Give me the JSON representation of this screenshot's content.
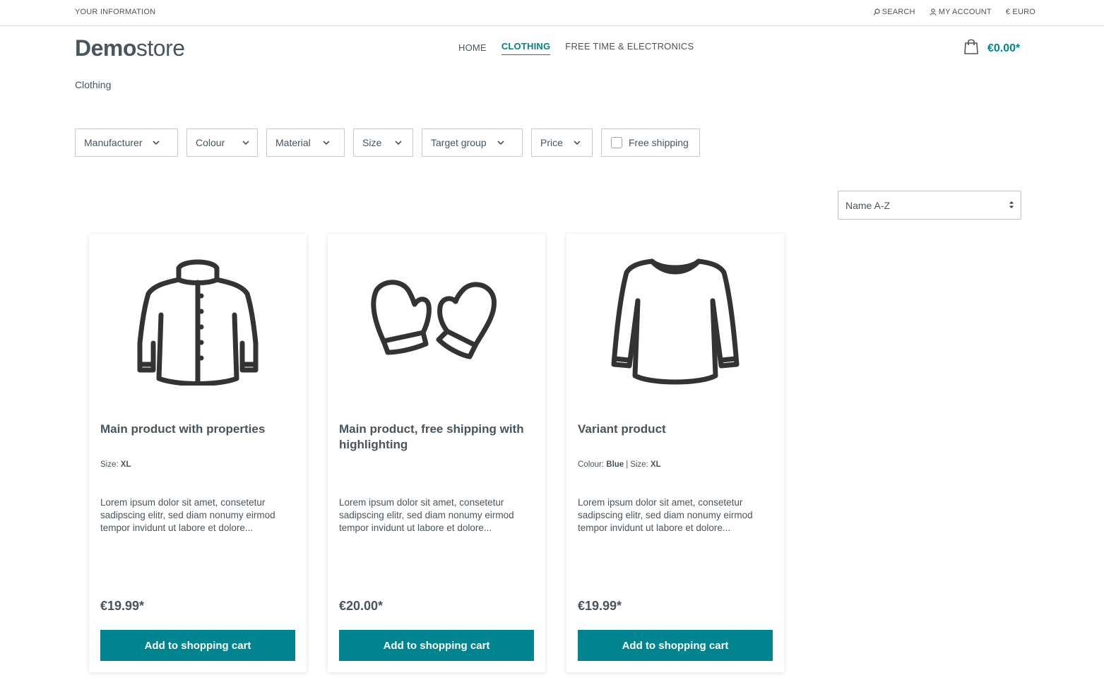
{
  "topbar": {
    "info_label": "YOUR INFORMATION",
    "search_label": "SEARCH",
    "account_label": "MY ACCOUNT",
    "currency_label": "€ EURO"
  },
  "header": {
    "logo_bold": "Demo",
    "logo_light": "store",
    "nav": [
      "HOME",
      "CLOTHING",
      "FREE TIME & ELECTRONICS"
    ],
    "active_nav": "CLOTHING",
    "cart_amount": "€0.00*"
  },
  "breadcrumb": "Clothing",
  "filters": {
    "manufacturer": "Manufacturer",
    "colour": "Colour",
    "material": "Material",
    "size": "Size",
    "target_group": "Target group",
    "price": "Price",
    "free_shipping": "Free shipping"
  },
  "sort": {
    "selected": "Name A-Z"
  },
  "products": [
    {
      "title": "Main product with properties",
      "props": [
        {
          "label": "Size:",
          "value": "XL"
        }
      ],
      "description": "Lorem ipsum dolor sit amet, consetetur sadipscing elitr, sed diam nonumy eirmod tempor invidunt ut labore et dolore...",
      "price": "€19.99*",
      "button": "Add to shopping cart",
      "icon": "jacket-icon"
    },
    {
      "title": "Main product, free shipping with highlighting",
      "props": [],
      "description": "Lorem ipsum dolor sit amet, consetetur sadipscing elitr, sed diam nonumy eirmod tempor invidunt ut labore et dolore...",
      "price": "€20.00*",
      "button": "Add to shopping cart",
      "icon": "mittens-icon"
    },
    {
      "title": "Variant product",
      "props": [
        {
          "label": "Colour:",
          "value": "Blue"
        },
        {
          "label": "Size:",
          "value": "XL"
        }
      ],
      "description": "Lorem ipsum dolor sit amet, consetetur sadipscing elitr, sed diam nonumy eirmod tempor invidunt ut labore et dolore...",
      "price": "€19.99*",
      "button": "Add to shopping cart",
      "icon": "sweater-icon"
    }
  ],
  "colors": {
    "accent": "#008490",
    "text": "#4a545b",
    "icon": "#333333"
  }
}
